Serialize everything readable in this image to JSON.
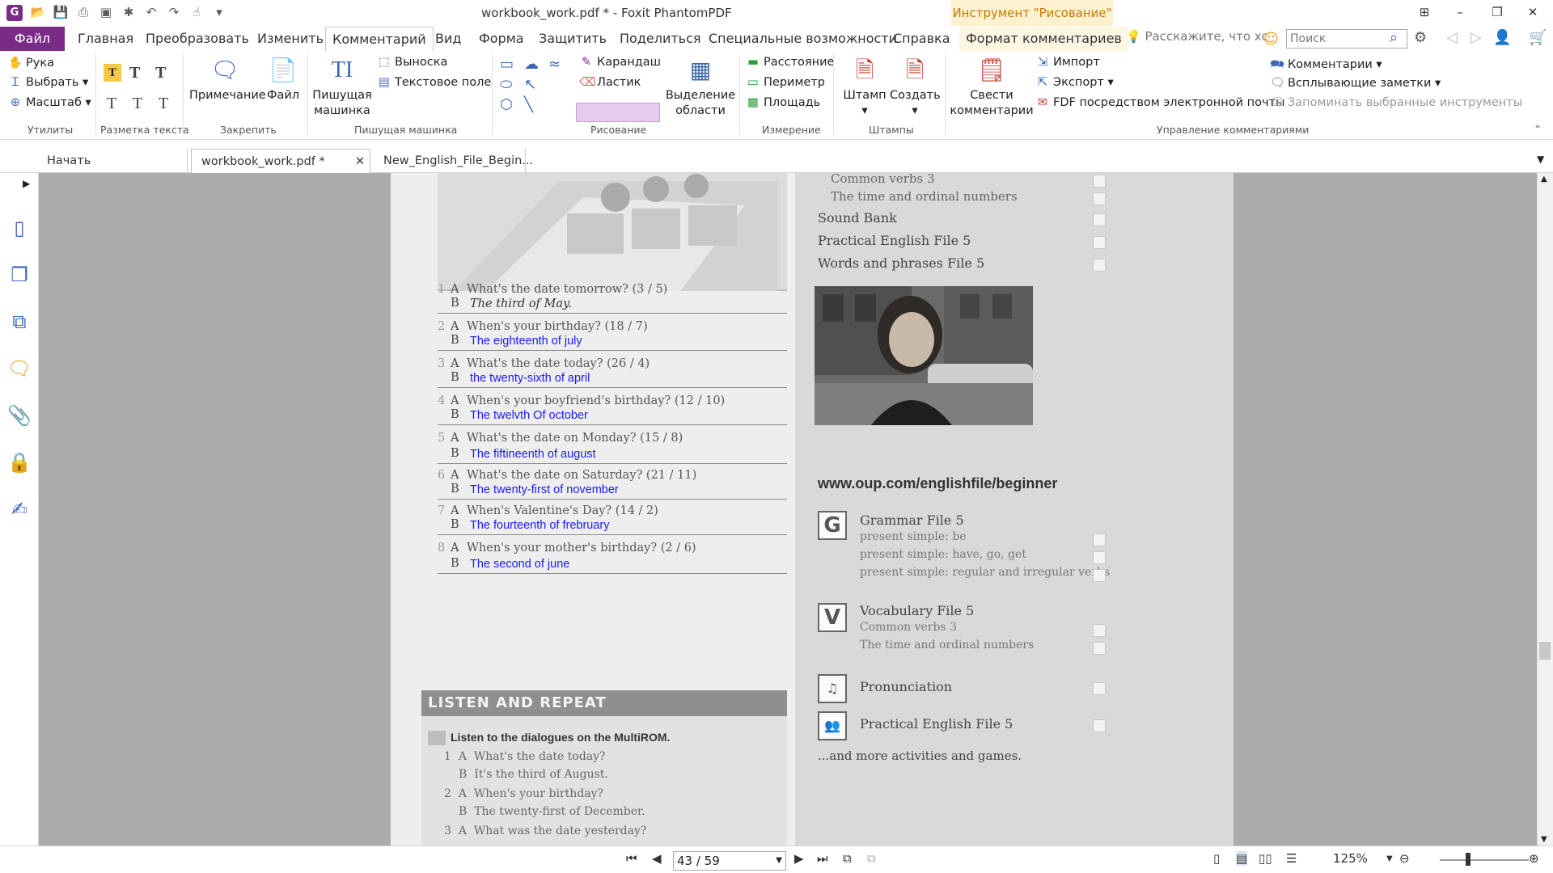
{
  "window": {
    "title": "workbook_work.pdf * - Foxit PhantomPDF",
    "context_tool": "Инструмент \"Рисование\""
  },
  "menu_tabs": [
    "Файл",
    "Главная",
    "Преобразовать",
    "Изменить",
    "Комментарий",
    "Вид",
    "Форма",
    "Защитить",
    "Поделиться",
    "Специальные возможности",
    "Справка",
    "Формат комментариев"
  ],
  "active_tab": "Комментарий",
  "tell_me": "Расскажите, что хс",
  "search_placeholder": "Поиск",
  "ribbon": {
    "utilities": {
      "hand": "Рука",
      "select": "Выбрать",
      "zoom": "Масштаб",
      "label": "Утилиты"
    },
    "text_markup": {
      "label": "Разметка текста"
    },
    "pin": {
      "note": "Примечание",
      "file": "Файл",
      "label": "Закрепить"
    },
    "typewriter": {
      "big": "Пишущая машинка",
      "callout": "Выноска",
      "textbox": "Текстовое поле",
      "label": "Пишущая машинка"
    },
    "drawing": {
      "pencil": "Карандаш",
      "eraser": "Ластик",
      "area": "Выделение области",
      "label": "Рисование"
    },
    "measure": {
      "distance": "Расстояние",
      "perimeter": "Периметр",
      "area": "Площадь",
      "label": "Измерение"
    },
    "stamps": {
      "stamp": "Штамп",
      "create": "Создать",
      "label": "Штампы"
    },
    "manage": {
      "summarize": "Свести комментарии",
      "import": "Импорт",
      "export": "Экспорт",
      "fdf": "FDF посредством электронной почты",
      "comments": "Комментарии",
      "popups": "Всплывающие заметки",
      "remember": "Запоминать выбранные инструменты",
      "label": "Управление комментариями"
    }
  },
  "doc_tabs": [
    "Начать",
    "workbook_work.pdf *",
    "New_English_File_Begin..."
  ],
  "document": {
    "questions": [
      {
        "n": "1",
        "q": "What's the date tomorrow? (3 / 5)",
        "a": "The third of May.",
        "handwritten": true
      },
      {
        "n": "2",
        "q": "When's your birthday? (18 / 7)",
        "a": "The eighteenth of july"
      },
      {
        "n": "3",
        "q": "What's the date today? (26 / 4)",
        "a": "the twenty-sixth of april"
      },
      {
        "n": "4",
        "q": "When's your boyfriend's birthday? (12 / 10)",
        "a": "The twelvth Of october"
      },
      {
        "n": "5",
        "q": "What's the date on Monday? (15 / 8)",
        "a": "The fiftineenth of august"
      },
      {
        "n": "6",
        "q": "What's the date on Saturday? (21 / 11)",
        "a": "The twenty-first of  november"
      },
      {
        "n": "7",
        "q": "When's Valentine's Day? (14 / 2)",
        "a": "The fourteenth of frebruary"
      },
      {
        "n": "8",
        "q": "When's your mother's birthday? (2 / 6)",
        "a": "The second of june"
      }
    ],
    "listen_header": "LISTEN AND REPEAT",
    "listen_intro": "Listen to the dialogues on the MultiROM.",
    "listen_lines": [
      {
        "n": "1",
        "s": "A",
        "t": "What's the date today?"
      },
      {
        "n": "",
        "s": "B",
        "t": "It's the third of August."
      },
      {
        "n": "2",
        "s": "A",
        "t": "When's your birthday?"
      },
      {
        "n": "",
        "s": "B",
        "t": "The twenty-first of December."
      },
      {
        "n": "3",
        "s": "A",
        "t": "What was the date yesterday?"
      }
    ],
    "right_top": [
      "Common verbs 3",
      "The time and ordinal numbers",
      "Sound Bank",
      "Practical English File 5",
      "Words and phrases File 5"
    ],
    "url": "www.oup.com/englishfile/beginner",
    "grammar": {
      "letter": "G",
      "title": "Grammar File 5",
      "items": [
        "present simple: be",
        "present simple: have, go, get",
        "present simple: regular and irregular verbs"
      ]
    },
    "vocab": {
      "letter": "V",
      "title": "Vocabulary File 5",
      "items": [
        "Common verbs 3",
        "The time and ordinal numbers"
      ]
    },
    "pron": "Pronunciation",
    "practical": "Practical English File 5",
    "more": "...and more activities and games."
  },
  "status": {
    "page": "43 / 59",
    "zoom": "125%"
  },
  "colors": {
    "brand": "#7a2b86",
    "annotation_blue": "#1a1aff"
  }
}
